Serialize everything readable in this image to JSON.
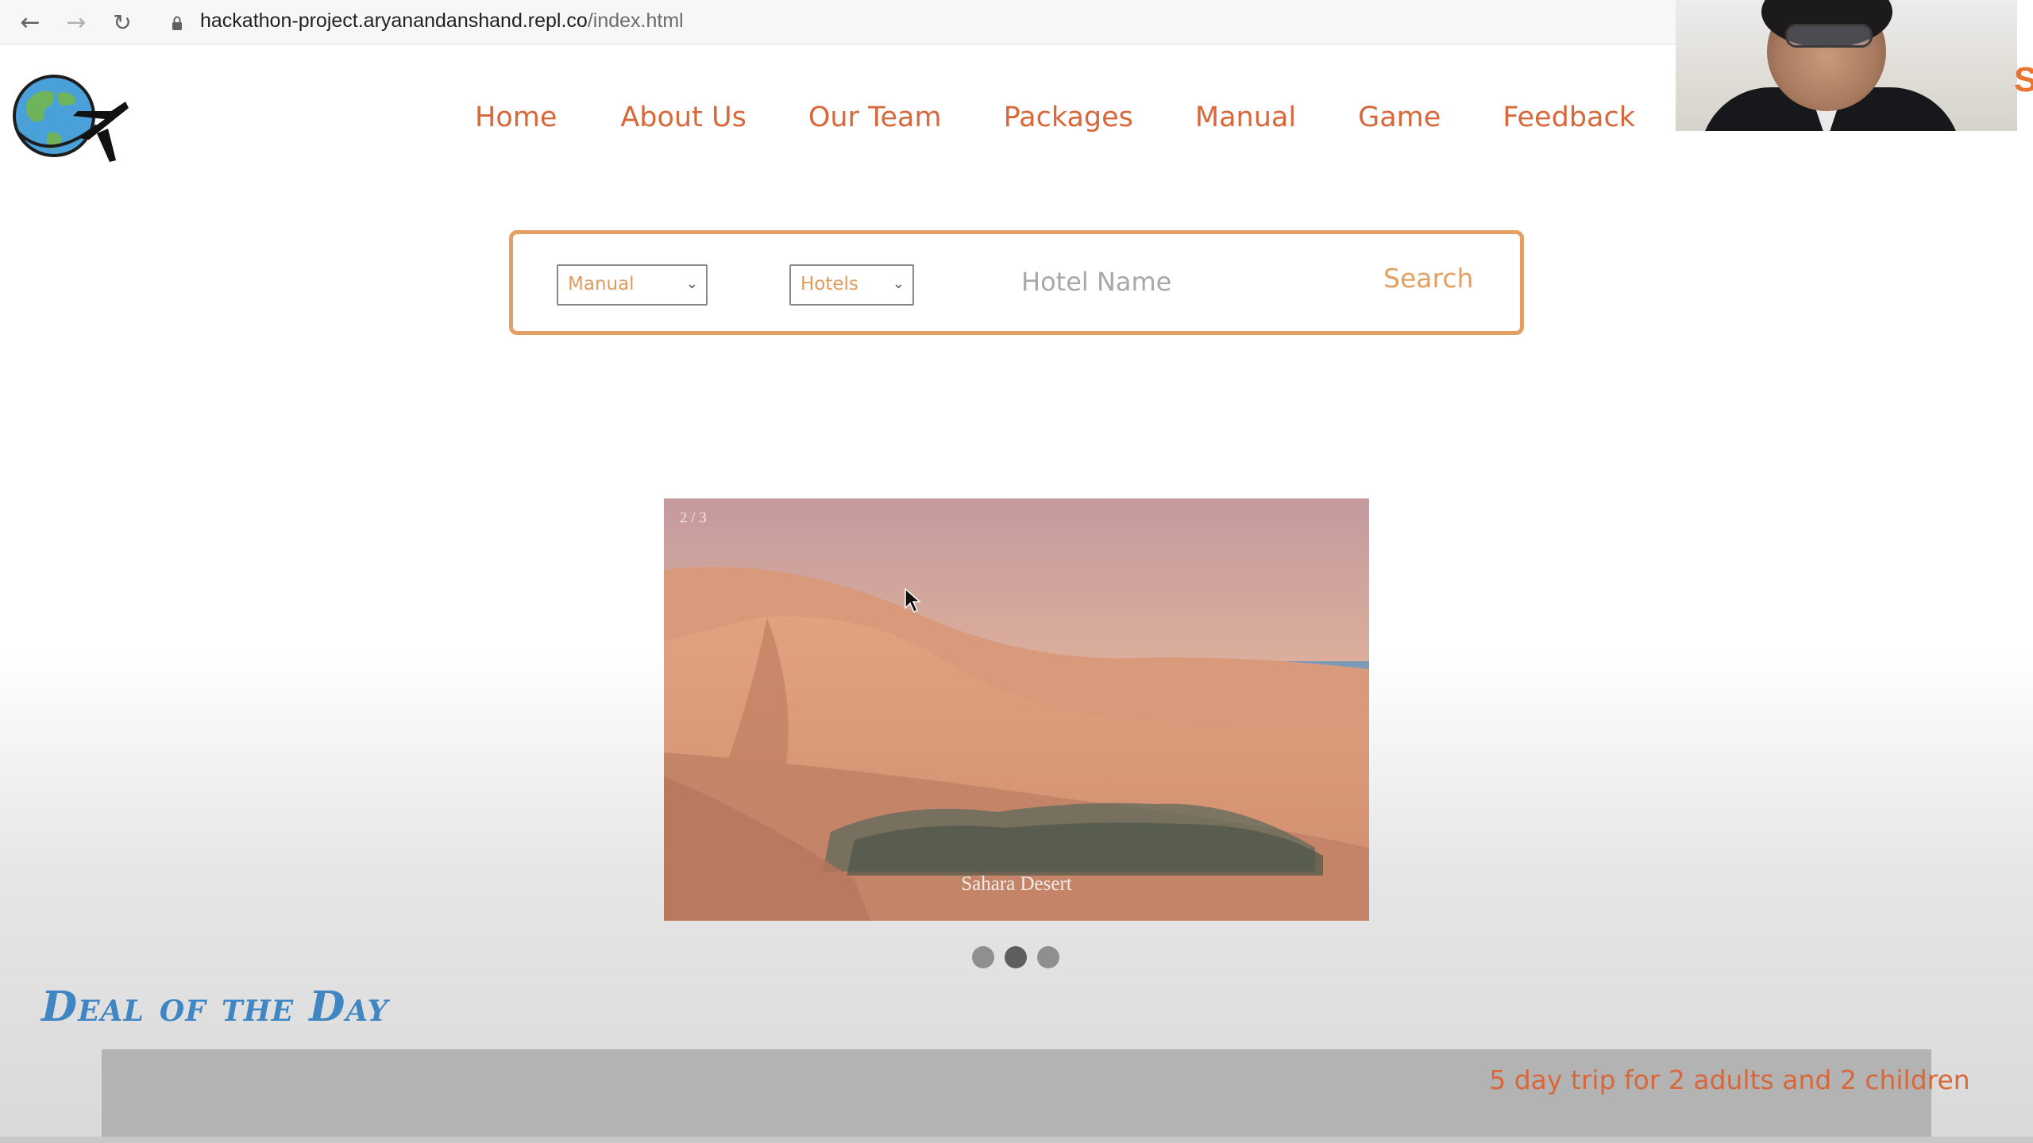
{
  "browser": {
    "url_host": "hackathon-project.aryanandanshand.repl.co",
    "url_path": "/index.html",
    "back_icon": "arrow-left-icon",
    "forward_icon": "arrow-right-icon",
    "reload_icon": "reload-icon"
  },
  "nav": {
    "items": [
      {
        "label": "Home"
      },
      {
        "label": "About Us"
      },
      {
        "label": "Our Team"
      },
      {
        "label": "Packages"
      },
      {
        "label": "Manual"
      },
      {
        "label": "Game"
      },
      {
        "label": "Feedback"
      }
    ]
  },
  "search": {
    "mode_value": "Manual",
    "type_value": "Hotels",
    "hotel_placeholder": "Hotel Name",
    "button_label": "Search"
  },
  "slideshow": {
    "counter": "2 / 3",
    "caption": "Sahara Desert",
    "current_slide": 2,
    "total_slides": 3
  },
  "deal": {
    "title": "Deal of the Day",
    "text": "5 day trip for 2 adults and 2 children"
  },
  "overlay": {
    "edge_letter": "S"
  },
  "colors": {
    "nav_text": "#d8683a",
    "search_accent": "#e3a062",
    "deal_title": "#3f86c2"
  }
}
